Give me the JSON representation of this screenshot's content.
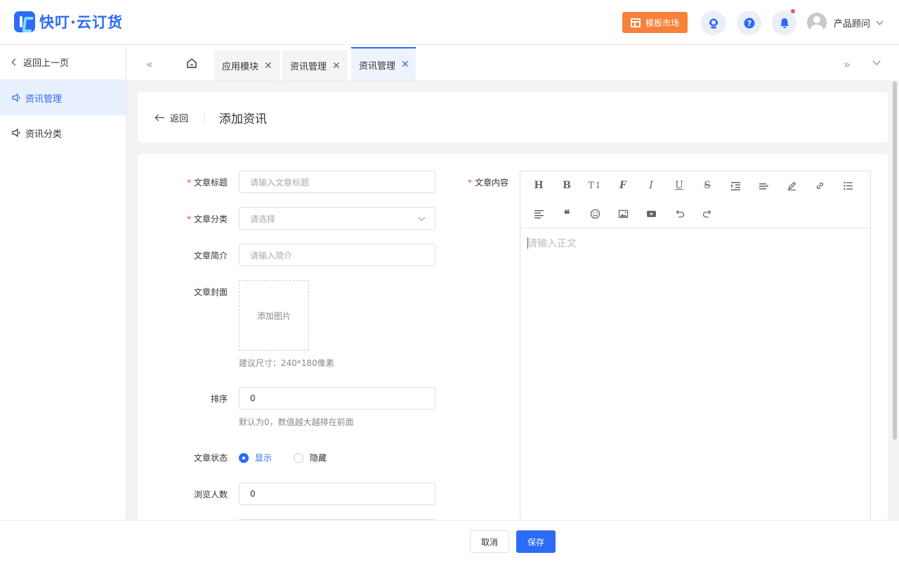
{
  "header": {
    "logo_text": "快叮·云订货",
    "market_button": "模板市场",
    "user_name": "产品顾问",
    "icons": [
      "service-icon",
      "help-icon",
      "bell-icon"
    ],
    "accent_color": "#2d6bf6",
    "market_color": "#f7803a"
  },
  "sidebar": {
    "back_label": "返回上一页",
    "items": [
      {
        "label": "资讯管理",
        "active": true
      },
      {
        "label": "资讯分类",
        "active": false
      }
    ]
  },
  "tabs": [
    {
      "label": "应用模块",
      "active": false
    },
    {
      "label": "资讯管理",
      "active": false
    },
    {
      "label": "资讯管理",
      "active": true
    }
  ],
  "page": {
    "back_label": "返回",
    "title": "添加资讯"
  },
  "form": {
    "title_label": "文章标题",
    "title_placeholder": "请输入文章标题",
    "category_label": "文章分类",
    "category_placeholder": "请选择",
    "summary_label": "文章简介",
    "summary_placeholder": "请输入简介",
    "cover_label": "文章封面",
    "cover_upload": "添加图片",
    "cover_hint": "建议尺寸：240*180像素",
    "sort_label": "排序",
    "sort_value": "0",
    "sort_hint": "默认为0，数值越大越排在前面",
    "status_label": "文章状态",
    "status_options": [
      "显示",
      "隐藏"
    ],
    "status_selected": "显示",
    "views_label": "浏览人数",
    "views_value": "0",
    "content_label": "文章内容",
    "content_placeholder": "请输入正文"
  },
  "editor_tools": [
    "H",
    "B",
    "T↕",
    "F",
    "I",
    "U",
    "S"
  ],
  "footer": {
    "cancel": "取消",
    "save": "保存"
  }
}
